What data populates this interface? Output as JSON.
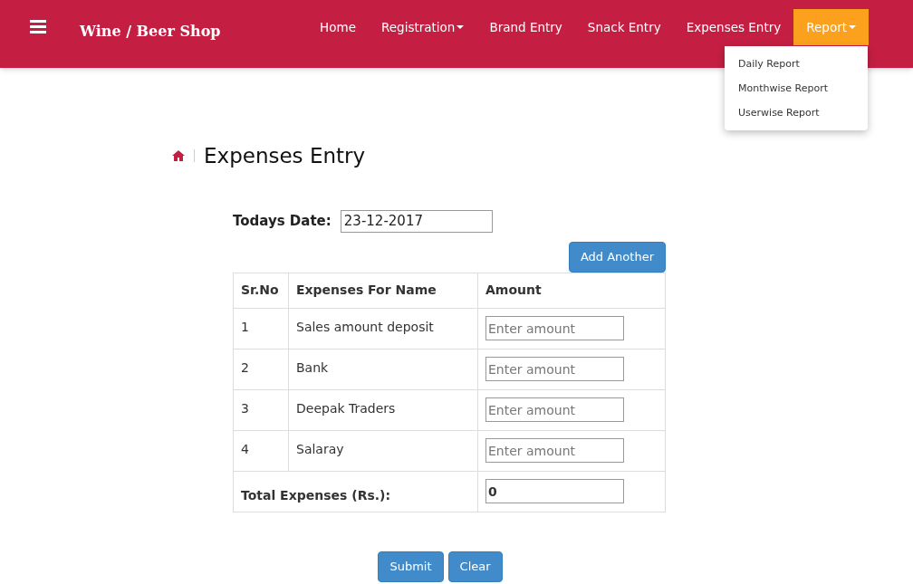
{
  "navbar": {
    "brand": "Wine / Beer Shop",
    "items": [
      {
        "label": "Home",
        "dropdown": false,
        "selected": false
      },
      {
        "label": "Registration",
        "dropdown": true,
        "selected": false
      },
      {
        "label": "Brand Entry",
        "dropdown": false,
        "selected": false
      },
      {
        "label": "Snack Entry",
        "dropdown": false,
        "selected": false
      },
      {
        "label": "Expenses Entry",
        "dropdown": false,
        "selected": false
      },
      {
        "label": "Report",
        "dropdown": true,
        "selected": true
      }
    ],
    "open_menu": [
      "Daily Report",
      "Monthwise Report",
      "Userwise Report"
    ]
  },
  "page_title": "Expenses Entry",
  "date": {
    "label": "Todays Date:",
    "value": "23-12-2017"
  },
  "add_button": "Add Another",
  "table": {
    "columns": [
      "Sr.No",
      "Expenses For Name",
      "Amount"
    ],
    "rows": [
      {
        "no": "1",
        "name": "Sales amount deposit",
        "placeholder": "Enter amount"
      },
      {
        "no": "2",
        "name": "Bank",
        "placeholder": "Enter amount"
      },
      {
        "no": "3",
        "name": "Deepak Traders",
        "placeholder": "Enter amount"
      },
      {
        "no": "4",
        "name": "Salaray",
        "placeholder": "Enter amount"
      }
    ],
    "total_label": "Total Expenses (Rs.):",
    "total_value": "0"
  },
  "buttons": [
    "Submit",
    "Clear"
  ]
}
